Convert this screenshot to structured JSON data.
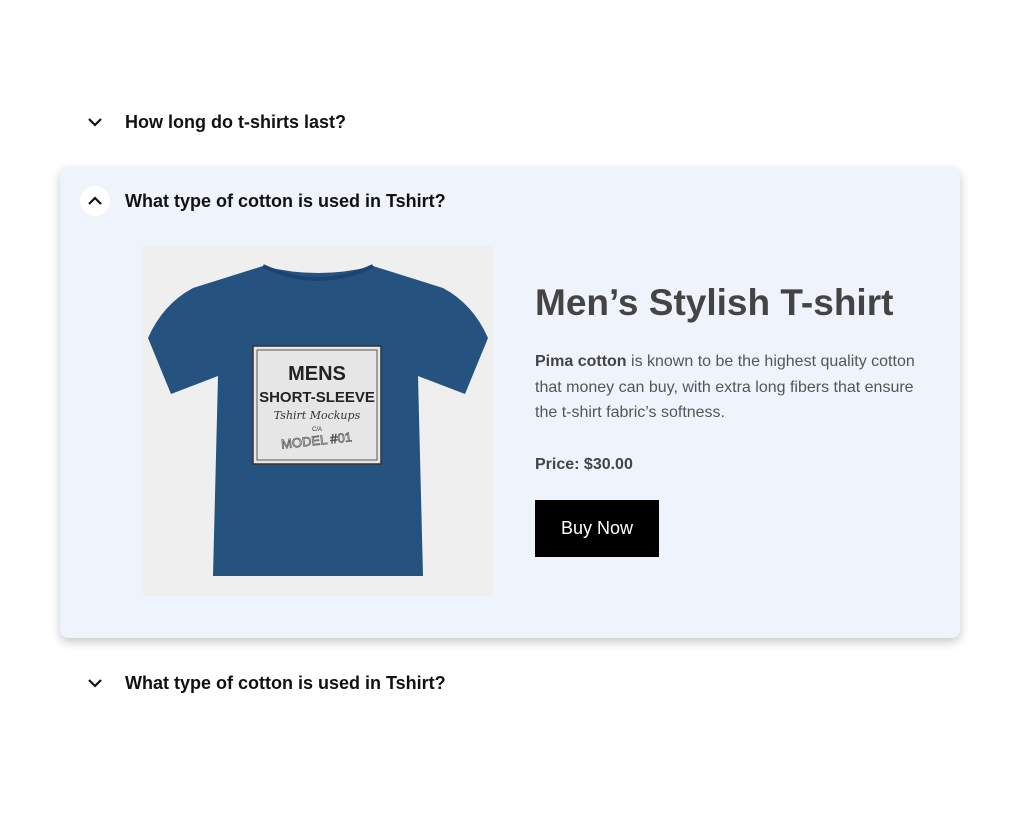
{
  "faq": {
    "items": [
      {
        "question": "How long do t-shirts last?",
        "expanded": false,
        "icon": "chevron-down-icon"
      },
      {
        "question": "What type of cotton is used in Tshirt?",
        "expanded": true,
        "icon": "chevron-up-icon"
      },
      {
        "question": "What type of cotton is used in Tshirt?",
        "expanded": false,
        "icon": "chevron-down-icon"
      }
    ],
    "product": {
      "title": "Men’s Stylish T-shirt",
      "desc_bold": "Pima cotton",
      "desc_rest": " is known to be the highest quality cotton that money can buy, with extra long fibers that ensure the t-shirt fabric’s softness.",
      "price": "Price: $30.00",
      "buy_label": "Buy Now",
      "image": {
        "shirt_color": "#26527f",
        "label_lines": [
          "MENS",
          "SHORT-SLEEVE",
          "Tshirt Mockups",
          "C/A",
          "MODEL #01"
        ]
      }
    }
  },
  "colors": {
    "panel_bg": "#eef3fc",
    "button_bg": "#000000",
    "heading": "#444444"
  }
}
